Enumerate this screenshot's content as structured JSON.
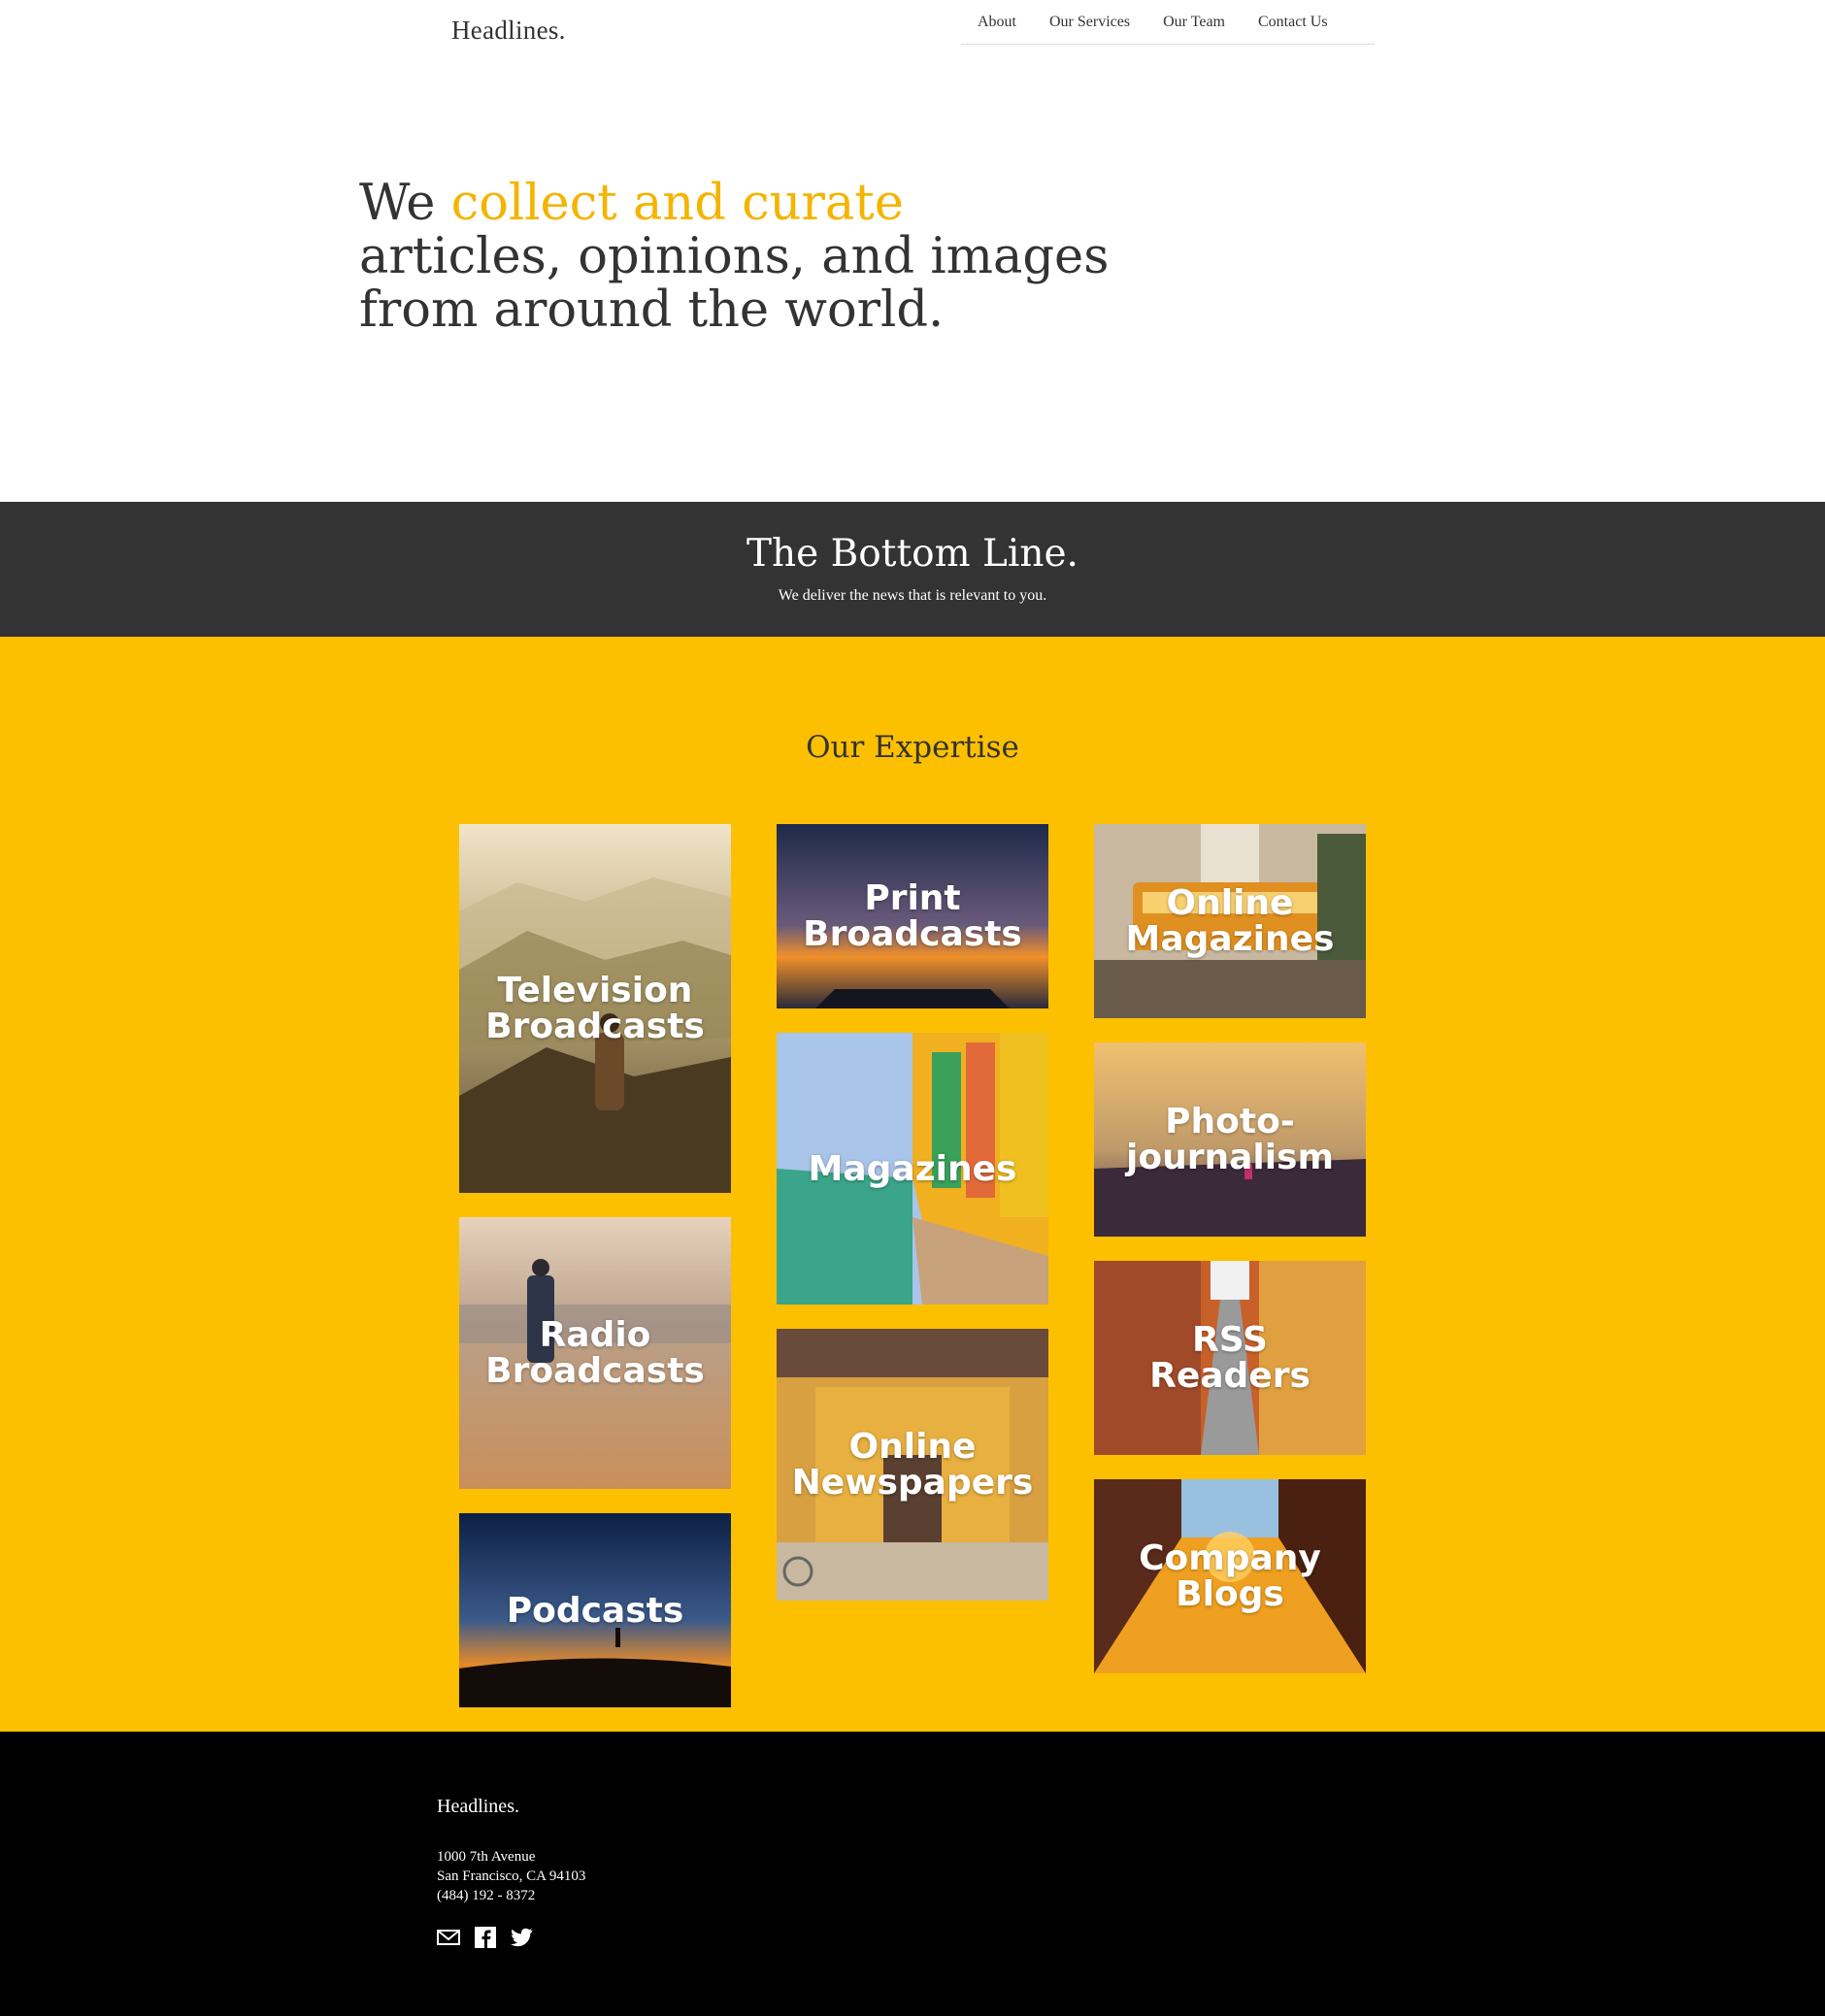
{
  "header": {
    "logo": "Headlines.",
    "nav": [
      "About",
      "Our Services",
      "Our Team",
      "Contact Us"
    ]
  },
  "hero": {
    "prefix": "We ",
    "accent": "collect and curate",
    "line2": "articles, opinions, and images",
    "line3": "from around the world."
  },
  "band": {
    "title": "The Bottom Line.",
    "subtitle": "We deliver the news that is relevant to you."
  },
  "expertise": {
    "title": "Our Expertise",
    "tiles": [
      {
        "label_line1": "Television",
        "label_line2": "Broadcasts"
      },
      {
        "label_line1": "Radio",
        "label_line2": "Broadcasts"
      },
      {
        "label_line1": "Podcasts",
        "label_line2": ""
      },
      {
        "label_line1": "Print",
        "label_line2": "Broadcasts"
      },
      {
        "label_line1": "Magazines",
        "label_line2": ""
      },
      {
        "label_line1": "Online",
        "label_line2": "Newspapers"
      },
      {
        "label_line1": "Online",
        "label_line2": "Magazines"
      },
      {
        "label_line1": "Photo-",
        "label_line2": "journalism"
      },
      {
        "label_line1": "RSS",
        "label_line2": "Readers"
      },
      {
        "label_line1": "Company",
        "label_line2": "Blogs"
      }
    ]
  },
  "footer": {
    "logo": "Headlines.",
    "address_line1": "1000 7th Avenue",
    "address_line2": "San Francisco, CA 94103",
    "phone": "(484) 192 - 8372",
    "socials": [
      "mail-icon",
      "facebook-icon",
      "twitter-icon"
    ]
  },
  "colors": {
    "accent": "#fcc000",
    "headline_accent": "#f4b400",
    "dark_band": "#333333",
    "footer": "#000000"
  }
}
